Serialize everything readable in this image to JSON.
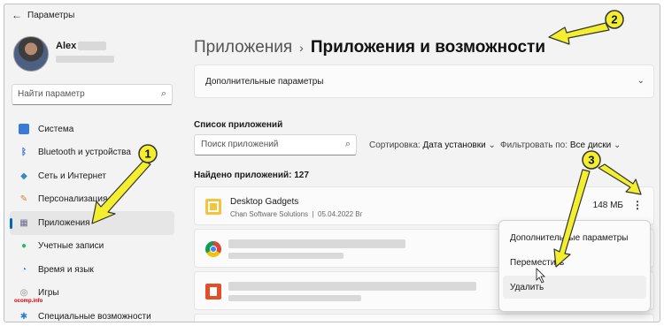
{
  "titlebar": {
    "back_icon": "arrow-left-icon",
    "title": "Параметры"
  },
  "user": {
    "name": "Alex"
  },
  "sidebar": {
    "search_placeholder": "Найти параметр",
    "items": [
      {
        "label": "Система",
        "icon": "monitor-icon",
        "color": "#3a7bd5"
      },
      {
        "label": "Bluetooth и устройства",
        "icon": "bluetooth-icon",
        "color": "#2a6fcf"
      },
      {
        "label": "Сеть и Интернет",
        "icon": "wifi-icon",
        "color": "#3a86c8"
      },
      {
        "label": "Персонализация",
        "icon": "brush-icon",
        "color": "#d9822b"
      },
      {
        "label": "Приложения",
        "icon": "apps-icon",
        "color": "#6b6b8a",
        "active": true
      },
      {
        "label": "Учетные записи",
        "icon": "person-icon",
        "color": "#2bb673"
      },
      {
        "label": "Время и язык",
        "icon": "globe-clock-icon",
        "color": "#2b7bd9"
      },
      {
        "label": "Игры",
        "icon": "gamepad-icon",
        "color": "#888888"
      },
      {
        "label": "Специальные возможности",
        "icon": "accessibility-icon",
        "color": "#2b7bd9"
      }
    ]
  },
  "header": {
    "parent": "Приложения",
    "separator": "›",
    "current": "Приложения и возможности"
  },
  "more_options": {
    "label": "Дополнительные параметры"
  },
  "apps_section": {
    "title": "Список приложений",
    "search_placeholder": "Поиск приложений",
    "sort_label": "Сортировка:",
    "sort_value": "Дата установки",
    "filter_label": "Фильтровать по:",
    "filter_value": "Все диски",
    "found": "Найдено приложений: 127"
  },
  "apps": [
    {
      "name": "Desktop Gadgets",
      "publisher": "Chan Software Solutions",
      "date": "05.04.2022 Вг",
      "size": "148 МБ",
      "icon": "gadgets-icon"
    },
    {
      "name": "",
      "icon": "chrome-icon"
    },
    {
      "name": "",
      "icon": "office-icon"
    }
  ],
  "context_menu": {
    "items": [
      "Дополнительные параметры",
      "Переместить",
      "Удалить"
    ],
    "hover_index": 2
  },
  "annotations": [
    {
      "number": "1"
    },
    {
      "number": "2"
    },
    {
      "number": "3"
    }
  ],
  "colors": {
    "accent": "#0067c0",
    "arrow": "#f3ee2e"
  },
  "watermark": "ocomp.info"
}
